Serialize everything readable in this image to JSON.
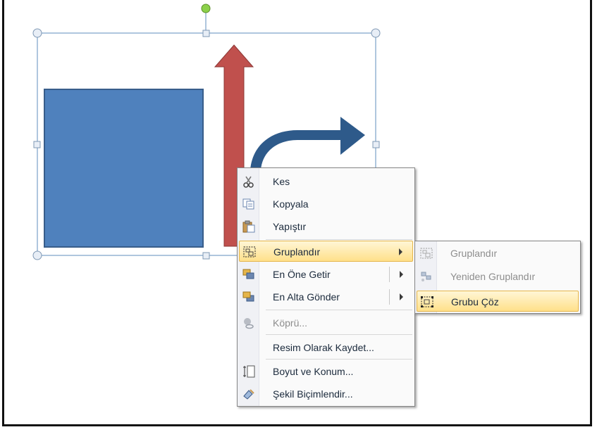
{
  "colors": {
    "square_fill": "#4f81bd",
    "square_stroke": "#385d8a",
    "arrow_up": "#c0504d",
    "arrow_bent": "#2e5a8a",
    "selection": "#7aa0c8",
    "rotate_handle": "#8cd14a",
    "highlight": "#ffe08a"
  },
  "menu": {
    "items": [
      {
        "label": "Kes",
        "icon": "scissors-icon"
      },
      {
        "label": "Kopyala",
        "icon": "copy-icon"
      },
      {
        "label": "Yapıştır",
        "icon": "paste-icon"
      },
      {
        "label": "Gruplandır",
        "icon": "group-icon",
        "highlighted": true,
        "submenu": true
      },
      {
        "label": "En Öne Getir",
        "icon": "bring-front-icon",
        "submenu": true
      },
      {
        "label": "En Alta Gönder",
        "icon": "send-back-icon",
        "submenu": true
      },
      {
        "label": "Köprü...",
        "icon": "hyperlink-icon",
        "disabled": true
      },
      {
        "label": "Resim Olarak Kaydet..."
      },
      {
        "label": "Boyut ve Konum...",
        "icon": "size-position-icon"
      },
      {
        "label": "Şekil Biçimlendir...",
        "icon": "format-shape-icon"
      }
    ]
  },
  "submenu": {
    "items": [
      {
        "label": "Gruplandır",
        "icon": "group-icon",
        "disabled": true
      },
      {
        "label": "Yeniden Gruplandır",
        "icon": "regroup-icon",
        "disabled": true
      },
      {
        "label": "Grubu Çöz",
        "icon": "ungroup-icon",
        "highlighted": true
      }
    ]
  }
}
